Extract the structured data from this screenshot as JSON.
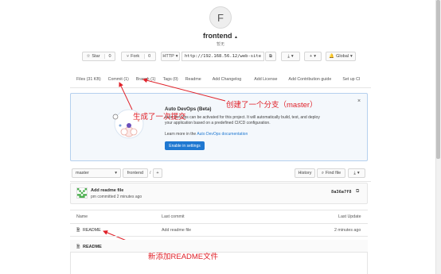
{
  "project": {
    "avatar_letter": "F",
    "name": "frontend",
    "name_icon": "🔒",
    "subtitle": "暂无"
  },
  "actions": {
    "star_label": "Star",
    "star_count": "0",
    "fork_label": "Fork",
    "fork_count": "0",
    "clone_protocol": "HTTP",
    "clone_url": "http://192.168.56.12/web-site",
    "plus_label": "+",
    "notify_label": "Global"
  },
  "tabs": [
    {
      "label": "Files (31 KB)"
    },
    {
      "label": "Commit (1)"
    },
    {
      "label": "Branch (1)"
    },
    {
      "label": "Tags (0)"
    },
    {
      "label": "Readme"
    },
    {
      "label": "Add Changelog"
    },
    {
      "label": "Add License"
    },
    {
      "label": "Add Contribution guide"
    },
    {
      "label": "Set up CI"
    }
  ],
  "banner": {
    "title": "Auto DevOps (Beta)",
    "text": "Auto DevOps can be activated for this project. It will automatically build, test, and deploy your application based on a predefined CI/CD configuration.",
    "learn_prefix": "Learn more in the ",
    "learn_link": "Auto DevOps documentation",
    "enable_label": "Enable in settings",
    "close": "×"
  },
  "annotations": {
    "branch_note": "创建了一个分支（master）",
    "commit_note": "生成了一次提交",
    "readme_note": "新添加README文件"
  },
  "controls": {
    "branch": "master",
    "path": "frontend",
    "path_sep": "/",
    "plus": "+",
    "history": "History",
    "find_file": "Find file"
  },
  "last_commit": {
    "title": "Add readme file",
    "meta": "pm committed 2 minutes ago",
    "sha": "8a36a7f8"
  },
  "table": {
    "headers": [
      "Name",
      "Last commit",
      "Last Update"
    ],
    "rows": [
      {
        "name": "README",
        "commit": "Add readme file",
        "updated": "2 minutes ago"
      }
    ]
  },
  "readme": {
    "title": "README"
  },
  "colors": {
    "accent": "#1f78d1",
    "annotation": "#e0222a",
    "banner_bg": "#f4f8fc"
  }
}
